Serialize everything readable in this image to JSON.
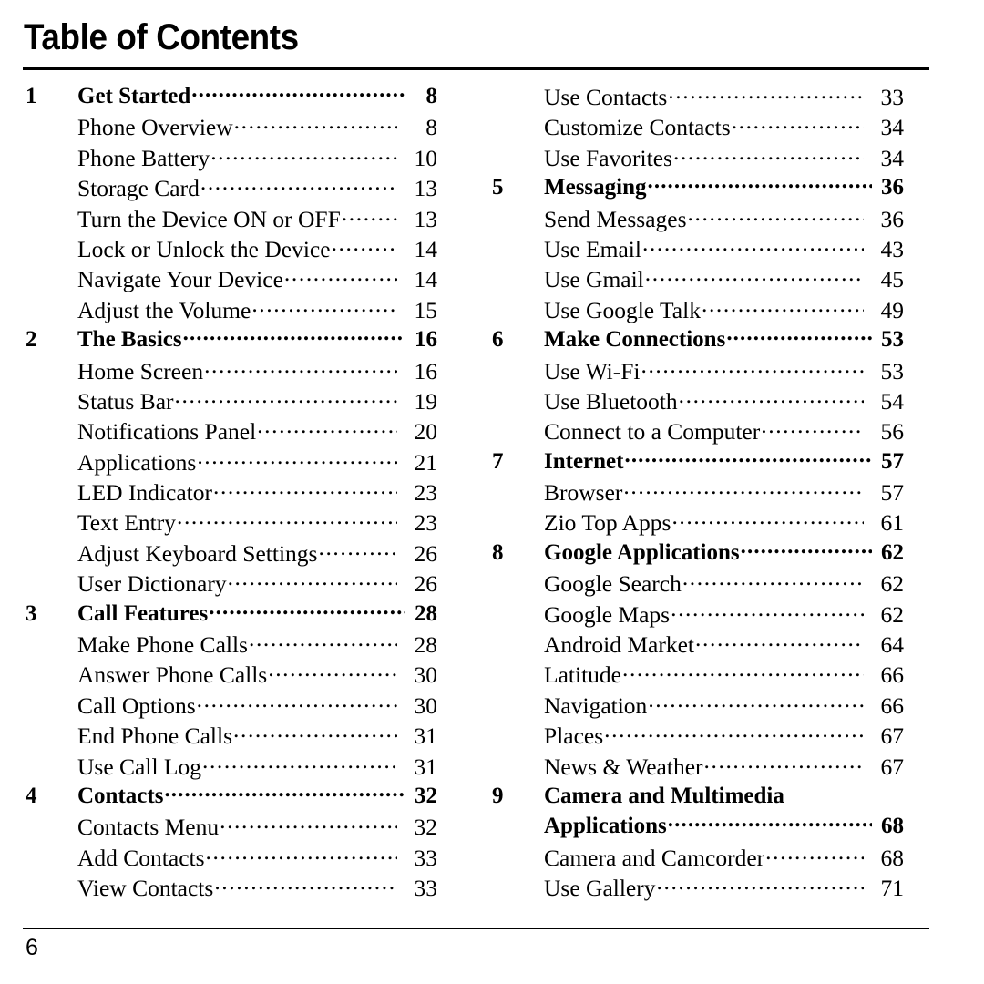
{
  "document": {
    "title": "Table of Contents",
    "footer_page_number": "6"
  },
  "left_column": [
    {
      "type": "chapter",
      "number": "1",
      "label": "Get Started",
      "page": "8"
    },
    {
      "type": "sub",
      "number": "",
      "label": "Phone Overview",
      "page": "8"
    },
    {
      "type": "sub",
      "number": "",
      "label": "Phone Battery",
      "page": "10"
    },
    {
      "type": "sub",
      "number": "",
      "label": "Storage Card",
      "page": "13"
    },
    {
      "type": "sub",
      "number": "",
      "label": "Turn the Device ON or OFF",
      "page": "13"
    },
    {
      "type": "sub",
      "number": "",
      "label": "Lock or Unlock the Device",
      "page": "14"
    },
    {
      "type": "sub",
      "number": "",
      "label": "Navigate Your Device",
      "page": "14"
    },
    {
      "type": "sub",
      "number": "",
      "label": "Adjust the Volume",
      "page": "15"
    },
    {
      "type": "chapter",
      "number": "2",
      "label": "The Basics",
      "page": "16"
    },
    {
      "type": "sub",
      "number": "",
      "label": "Home Screen",
      "page": "16"
    },
    {
      "type": "sub",
      "number": "",
      "label": "Status Bar",
      "page": "19"
    },
    {
      "type": "sub",
      "number": "",
      "label": "Notifications Panel",
      "page": "20"
    },
    {
      "type": "sub",
      "number": "",
      "label": "Applications",
      "page": "21"
    },
    {
      "type": "sub",
      "number": "",
      "label": "LED Indicator",
      "page": "23"
    },
    {
      "type": "sub",
      "number": "",
      "label": "Text Entry",
      "page": "23"
    },
    {
      "type": "sub",
      "number": "",
      "label": "Adjust Keyboard Settings",
      "page": "26"
    },
    {
      "type": "sub",
      "number": "",
      "label": "User Dictionary",
      "page": "26"
    },
    {
      "type": "chapter",
      "number": "3",
      "label": "Call Features",
      "page": "28"
    },
    {
      "type": "sub",
      "number": "",
      "label": "Make Phone Calls",
      "page": "28"
    },
    {
      "type": "sub",
      "number": "",
      "label": "Answer Phone Calls",
      "page": "30"
    },
    {
      "type": "sub",
      "number": "",
      "label": "Call Options",
      "page": "30"
    },
    {
      "type": "sub",
      "number": "",
      "label": "End Phone Calls",
      "page": "31"
    },
    {
      "type": "sub",
      "number": "",
      "label": "Use Call Log",
      "page": "31"
    },
    {
      "type": "chapter",
      "number": "4",
      "label": "Contacts",
      "page": "32"
    },
    {
      "type": "sub",
      "number": "",
      "label": "Contacts Menu",
      "page": "32"
    },
    {
      "type": "sub",
      "number": "",
      "label": "Add Contacts",
      "page": "33"
    },
    {
      "type": "sub",
      "number": "",
      "label": "View Contacts",
      "page": "33"
    }
  ],
  "right_column": [
    {
      "type": "sub",
      "number": "",
      "label": "Use Contacts",
      "page": "33"
    },
    {
      "type": "sub",
      "number": "",
      "label": "Customize Contacts",
      "page": "34"
    },
    {
      "type": "sub",
      "number": "",
      "label": "Use Favorites",
      "page": "34"
    },
    {
      "type": "chapter",
      "number": "5",
      "label": "Messaging",
      "page": "36"
    },
    {
      "type": "sub",
      "number": "",
      "label": "Send Messages",
      "page": "36"
    },
    {
      "type": "sub",
      "number": "",
      "label": "Use Email",
      "page": "43"
    },
    {
      "type": "sub",
      "number": "",
      "label": "Use Gmail",
      "page": "45"
    },
    {
      "type": "sub",
      "number": "",
      "label": "Use Google Talk",
      "page": "49"
    },
    {
      "type": "chapter",
      "number": "6",
      "label": "Make Connections",
      "page": "53"
    },
    {
      "type": "sub",
      "number": "",
      "label": "Use Wi-Fi",
      "page": "53"
    },
    {
      "type": "sub",
      "number": "",
      "label": "Use Bluetooth",
      "page": "54"
    },
    {
      "type": "sub",
      "number": "",
      "label": "Connect to a Computer",
      "page": "56"
    },
    {
      "type": "chapter",
      "number": "7",
      "label": "Internet",
      "page": "57"
    },
    {
      "type": "sub",
      "number": "",
      "label": "Browser",
      "page": "57"
    },
    {
      "type": "sub",
      "number": "",
      "label": "Zio Top Apps",
      "page": "61"
    },
    {
      "type": "chapter",
      "number": "8",
      "label": "Google Applications",
      "page": "62"
    },
    {
      "type": "sub",
      "number": "",
      "label": "Google Search",
      "page": "62"
    },
    {
      "type": "sub",
      "number": "",
      "label": "Google Maps",
      "page": "62"
    },
    {
      "type": "sub",
      "number": "",
      "label": "Android Market",
      "page": "64"
    },
    {
      "type": "sub",
      "number": "",
      "label": "Latitude",
      "page": "66"
    },
    {
      "type": "sub",
      "number": "",
      "label": "Navigation",
      "page": "66"
    },
    {
      "type": "sub",
      "number": "",
      "label": "Places",
      "page": "67"
    },
    {
      "type": "sub",
      "number": "",
      "label": "News & Weather",
      "page": "67"
    },
    {
      "type": "chapter-continued",
      "number": "9",
      "label": "Camera and Multimedia",
      "page": ""
    },
    {
      "type": "chapter",
      "number": "",
      "label": "Applications",
      "page": "68"
    },
    {
      "type": "sub",
      "number": "",
      "label": "Camera and Camcorder",
      "page": "68"
    },
    {
      "type": "sub",
      "number": "",
      "label": "Use Gallery",
      "page": "71"
    }
  ]
}
